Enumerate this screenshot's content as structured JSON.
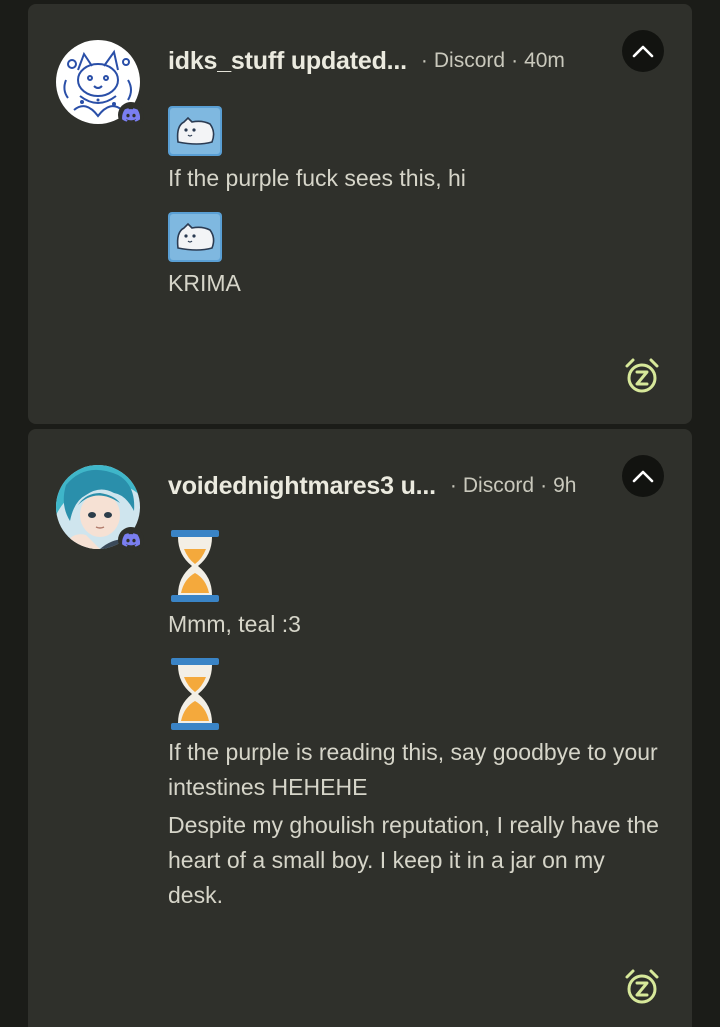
{
  "notifications": [
    {
      "sender": "idks_stuff updated...",
      "app": "Discord",
      "time": "40m",
      "messages": [
        {
          "text": "If the purple fuck sees this, hi",
          "icon": "stuffed-toy-icon"
        },
        {
          "text": "KRIMA",
          "icon": "stuffed-toy-icon"
        }
      ]
    },
    {
      "sender": "voidednightmares3 u...",
      "app": "Discord",
      "time": "9h",
      "messages": [
        {
          "text": "Mmm, teal :3",
          "icon": "hourglass-icon"
        },
        {
          "text": "If the purple is reading this, say goodbye to your intestines HEHEHE",
          "icon": "hourglass-icon"
        }
      ],
      "extra_text": "Despite my ghoulish reputation, I really have the heart of a small boy. I keep it in a jar on my desk."
    }
  ],
  "colors": {
    "background": "#1b1c18",
    "card": "#2f302b",
    "discord": "#7a7ef0",
    "snooze": "#d7e89a",
    "hourglass_frame": "#3a84c6",
    "hourglass_sand": "#f4a93c"
  }
}
